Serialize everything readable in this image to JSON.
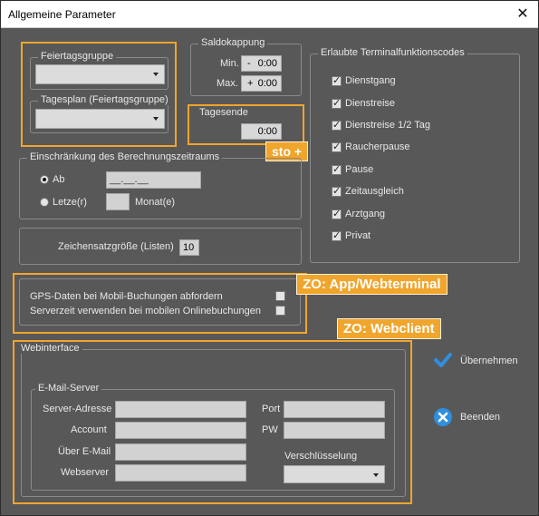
{
  "window": {
    "title": "Allgemeine Parameter",
    "close_glyph": "✕"
  },
  "feiertag": {
    "gruppe_label": "Feiertagsgruppe",
    "tagesplan_label": "Tagesplan (Feiertagsgruppe)"
  },
  "saldo": {
    "legend": "Saldokappung",
    "min_label": "Min.",
    "min_sign": "-",
    "min_value": "0:00",
    "max_label": "Max.",
    "max_sign": "+",
    "max_value": "0:00"
  },
  "tagesende": {
    "legend": "Tagesende",
    "value": "0:00",
    "tag": "sto +"
  },
  "terminal": {
    "legend": "Erlaubte Terminalfunktionscodes",
    "items": [
      {
        "label": "Dienstgang",
        "checked": true
      },
      {
        "label": "Dienstreise",
        "checked": true
      },
      {
        "label": "Dienstreise 1/2 Tag",
        "checked": true
      },
      {
        "label": "Raucherpause",
        "checked": true
      },
      {
        "label": "Pause",
        "checked": true
      },
      {
        "label": "Zeitausgleich",
        "checked": true
      },
      {
        "label": "Arztgang",
        "checked": true
      },
      {
        "label": "Privat",
        "checked": true
      }
    ]
  },
  "einschraenkung": {
    "legend": "Einschränkung des Berechnungszeitraums",
    "ab_label": "Ab",
    "ab_value": "__.__.__",
    "letzte_label": "Letze(r)",
    "monat_label": "Monat(e)"
  },
  "zeichensatz": {
    "label": "Zeichensatzgröße (Listen)",
    "value": "10"
  },
  "gps": {
    "tag": "ZO: App/Webterminal",
    "gps_label": "GPS-Daten bei Mobil-Buchungen abfordern",
    "server_label": "Serverzeit verwenden bei mobilen Onlinebuchungen"
  },
  "web": {
    "tag": "ZO: Webclient",
    "legend": "Webinterface",
    "email_legend": "E-Mail-Server",
    "server_adresse": "Server-Adresse",
    "account": "Account",
    "ueber_email": "Über E-Mail",
    "webserver": "Webserver",
    "port": "Port",
    "pw": "PW",
    "verschluesselung": "Verschlüsselung"
  },
  "actions": {
    "ok_label": "Übernehmen",
    "exit_label": "Beenden"
  },
  "colors": {
    "window_bg": "#585858",
    "highlight": "#f0a52c",
    "ok_blue": "#2f8fe0"
  }
}
